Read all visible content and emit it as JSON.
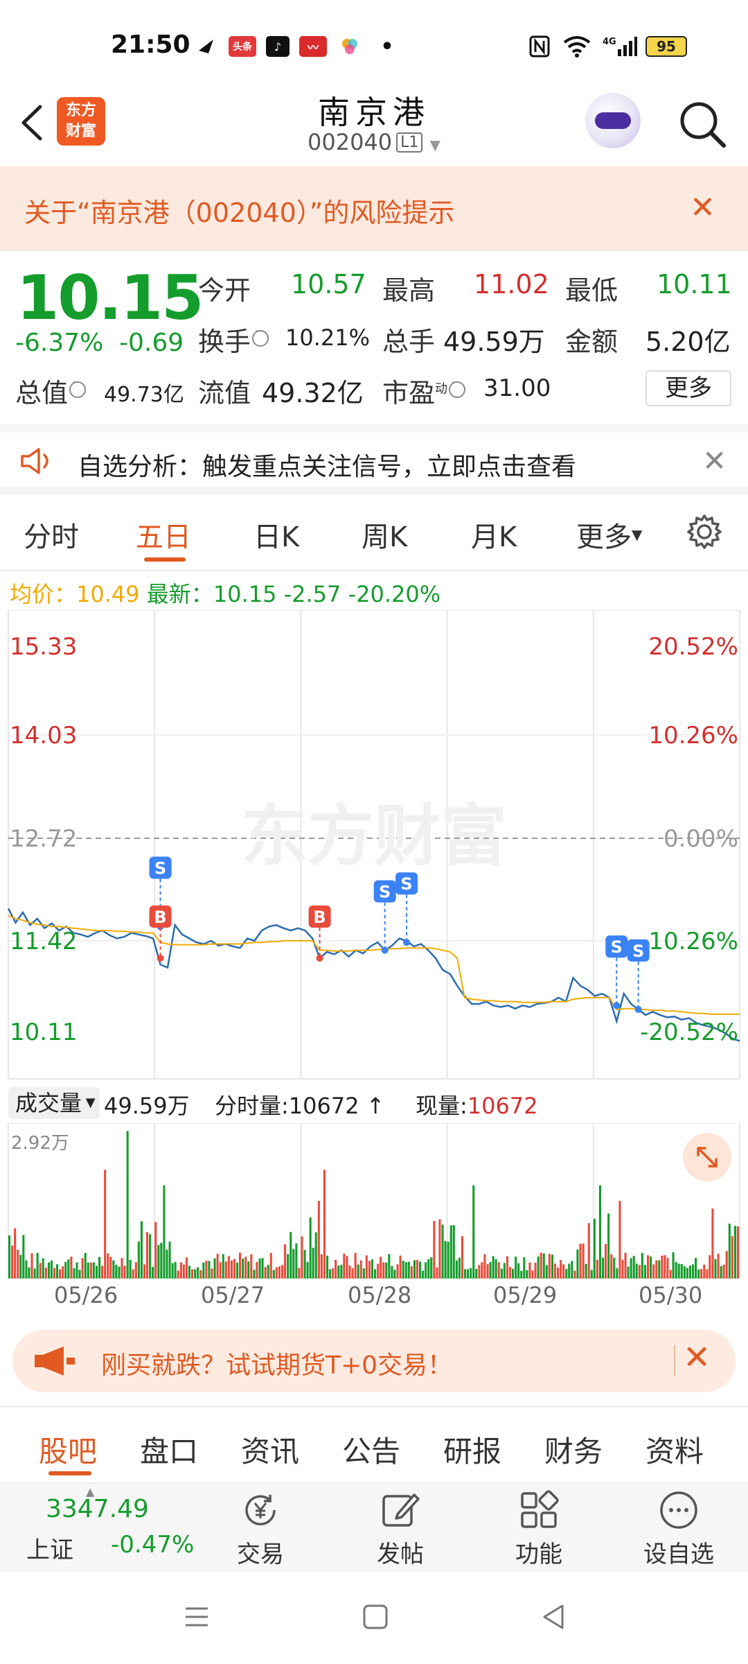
{
  "status_bar": {
    "time": "21:50",
    "notif_icons": [
      "feishu-icon",
      "toutiao-icon",
      "tiktok-icon",
      "stock-app-icon",
      "photos-icon"
    ],
    "battery": "95",
    "network": "4G"
  },
  "header": {
    "logo_line1": "东方",
    "logo_line2": "财富",
    "title": "南京港",
    "code": "002040",
    "level": "L1"
  },
  "risk_banner": {
    "text": "关于“南京港（002040）”的风险提示"
  },
  "quote": {
    "price": "10.15",
    "pct": "-6.37%",
    "change": "-0.69",
    "open_label": "今开",
    "open": "10.57",
    "high_label": "最高",
    "high": "11.02",
    "low_label": "最低",
    "low": "10.11",
    "turnover_label": "换手",
    "turnover": "10.21%",
    "volume_label": "总手",
    "volume": "49.59万",
    "amount_label": "金额",
    "amount": "5.20亿",
    "mcap_label": "总值",
    "mcap": "49.73亿",
    "float_label": "流值",
    "float_cap": "49.32亿",
    "pe_label": "市盈",
    "pe_sup": "动",
    "pe": "31.00",
    "more": "更多"
  },
  "notice": {
    "text": "自选分析：触发重点关注信号，立即点击查看"
  },
  "chart_tabs": [
    "分时",
    "五日",
    "日K",
    "周K",
    "月K",
    "更多"
  ],
  "active_chart_tab": "五日",
  "chart_header": {
    "avg_label": "均价：",
    "avg_value": "10.49",
    "latest_label": "最新：",
    "latest_value": "10.15",
    "latest_change": "-2.57",
    "latest_pct": "-20.20%"
  },
  "chart_data": {
    "type": "line",
    "title": "",
    "xlabel": "",
    "ylabel": "",
    "x": [
      "05/26",
      "05/27",
      "05/28",
      "05/29",
      "05/30"
    ],
    "y_axis_left": [
      "15.33",
      "14.03",
      "12.72",
      "11.42",
      "10.11"
    ],
    "y_axis_right": [
      "20.52%",
      "10.26%",
      "0.00%",
      "-10.26%",
      "-20.52%"
    ],
    "ylim": [
      10.11,
      15.33
    ],
    "reference_price": 12.72,
    "watermark": "东方财富",
    "series": [
      {
        "color": "#2b6cb0",
        "values": [
          11.83,
          11.65,
          11.78,
          11.62,
          11.7,
          11.58,
          11.64,
          11.55,
          11.6,
          11.52,
          11.5,
          11.47,
          11.52,
          11.55,
          11.49,
          11.45,
          11.47,
          11.52,
          11.5,
          11.48,
          11.45,
          11.12,
          11.08,
          11.62,
          11.5,
          11.45,
          11.4,
          11.38,
          11.42,
          11.36,
          11.38,
          11.35,
          11.33,
          11.45,
          11.42,
          11.55,
          11.6,
          11.62,
          11.58,
          11.55,
          11.58,
          11.55,
          11.45,
          11.2,
          11.28,
          11.25,
          11.3,
          11.22,
          11.3,
          11.26,
          11.35,
          11.4,
          11.3,
          11.36,
          11.45,
          11.42,
          11.35,
          11.38,
          11.3,
          11.2,
          11.05,
          11.0,
          10.85,
          10.72,
          10.62,
          10.62,
          10.65,
          10.6,
          10.58,
          10.6,
          10.56,
          10.6,
          10.58,
          10.62,
          10.63,
          10.65,
          10.7,
          10.65,
          10.95,
          10.85,
          10.8,
          10.72,
          10.75,
          10.7,
          10.4,
          10.75,
          10.62,
          10.55,
          10.48,
          10.52,
          10.48,
          10.45,
          10.46,
          10.42,
          10.44,
          10.38,
          10.35,
          10.33,
          10.3,
          10.25,
          10.18,
          10.15
        ]
      },
      {
        "color": "#f2a900",
        "values": [
          11.74,
          11.7,
          11.68,
          11.65,
          11.63,
          11.62,
          11.6,
          11.6,
          11.59,
          11.58,
          11.57,
          11.56,
          11.55,
          11.55,
          11.55,
          11.54,
          11.54,
          11.53,
          11.53,
          11.52,
          11.52,
          11.4,
          11.38,
          11.37,
          11.37,
          11.37,
          11.37,
          11.37,
          11.38,
          11.38,
          11.38,
          11.38,
          11.38,
          11.39,
          11.4,
          11.4,
          11.41,
          11.41,
          11.42,
          11.42,
          11.42,
          11.42,
          11.42,
          11.3,
          11.3,
          11.29,
          11.29,
          11.29,
          11.3,
          11.3,
          11.3,
          11.31,
          11.31,
          11.32,
          11.32,
          11.33,
          11.33,
          11.33,
          11.33,
          11.32,
          11.3,
          11.28,
          11.2,
          10.7,
          10.68,
          10.67,
          10.66,
          10.66,
          10.65,
          10.65,
          10.65,
          10.64,
          10.64,
          10.64,
          10.64,
          10.65,
          10.65,
          10.65,
          10.68,
          10.69,
          10.7,
          10.7,
          10.7,
          10.7,
          10.55,
          10.56,
          10.56,
          10.55,
          10.55,
          10.54,
          10.54,
          10.53,
          10.53,
          10.52,
          10.51,
          10.5,
          10.5,
          10.49,
          10.49,
          10.49,
          10.49,
          10.49
        ]
      }
    ],
    "trade_markers": [
      {
        "type": "S",
        "x_index": 21,
        "price": 11.6
      },
      {
        "type": "B",
        "x_index": 21,
        "price": 11.2
      },
      {
        "type": "B",
        "x_index": 43,
        "price": 11.2
      },
      {
        "type": "S",
        "x_index": 52,
        "price": 11.3
      },
      {
        "type": "S",
        "x_index": 55,
        "price": 11.4
      },
      {
        "type": "S",
        "x_index": 84,
        "price": 10.6
      },
      {
        "type": "S",
        "x_index": 87,
        "price": 10.55
      }
    ]
  },
  "volume_header": {
    "selector": "成交量",
    "total": "49.59万",
    "tick_label": "分时量:",
    "tick_value": "10672",
    "current_label": "现量:",
    "current_value": "10672",
    "max_label": "2.92万"
  },
  "date_axis": [
    "05/26",
    "05/27",
    "05/28",
    "05/29",
    "05/30"
  ],
  "promo": {
    "text": "刚买就跌？试试期货T+0交易！"
  },
  "bottom_tabs": [
    "股吧",
    "盘口",
    "资讯",
    "公告",
    "研报",
    "财务",
    "资料"
  ],
  "active_bottom_tab": "股吧",
  "toolbar": {
    "index_value": "3347.49",
    "index_name": "上证",
    "index_change": "-0.47%",
    "trade": "交易",
    "post": "发帖",
    "features": "功能",
    "add_watch": "设自选"
  }
}
